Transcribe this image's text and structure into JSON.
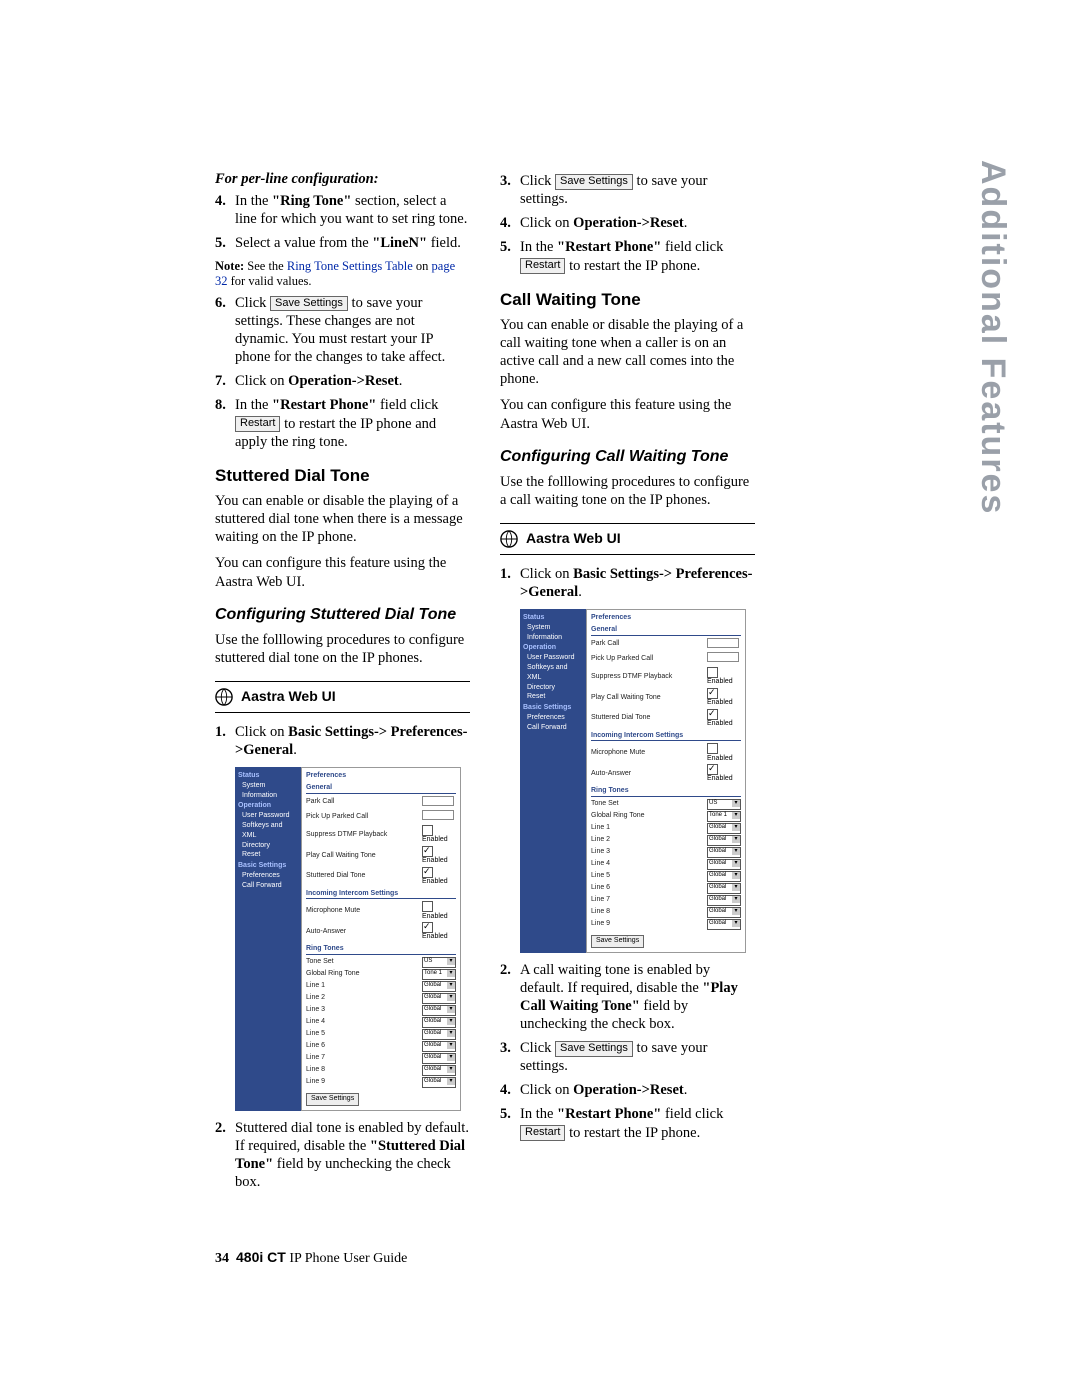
{
  "sideTab": "Additional Features",
  "footer": {
    "page": "34",
    "product": "480i CT",
    "rest": " IP Phone User Guide"
  },
  "leftCol": {
    "perLineHead": "For per-line configuration:",
    "step4": {
      "num": "4.",
      "pre": "In the ",
      "bold1": "\"Ring Tone\"",
      "post": " section, select a line for which you want to set ring tone."
    },
    "step5": {
      "num": "5.",
      "pre": "Select a value from the ",
      "bold1": "\"LineN\"",
      "post": " field."
    },
    "note": {
      "label": "Note:",
      "pre": " See the ",
      "link1": "Ring Tone Settings Table",
      "mid": " on ",
      "link2": "page 32",
      "post": " for valid values."
    },
    "step6": {
      "num": "6.",
      "pre": "Click ",
      "btn": "Save Settings",
      "post": " to save your settings. These changes are not dynamic. You must restart your IP phone for the changes to take affect."
    },
    "step7": {
      "num": "7.",
      "pre": "Click on ",
      "bold1": "Operation->Reset",
      "post": "."
    },
    "step8": {
      "num": "8.",
      "pre": "In the ",
      "bold1": "\"Restart Phone\"",
      "mid": " field click ",
      "btn": "Restart",
      "post": " to restart the IP phone and apply the ring tone."
    },
    "stutteredHead": "Stuttered Dial Tone",
    "stutteredP1": "You can enable or disable the playing of a stuttered dial tone when there is a message waiting on the IP phone.",
    "stutteredP2": "You can configure this feature using the Aastra Web UI.",
    "confStutteredHead": "Configuring Stuttered Dial Tone",
    "confStutteredP": "Use the folllowing procedures to configure stuttered dial tone on the IP phones.",
    "webui": "Aastra Web UI",
    "sStep1": {
      "num": "1.",
      "pre": "Click on ",
      "bold1": "Basic Settings-> Preferences->General",
      "post": "."
    },
    "sStep2": {
      "num": "2.",
      "pre": "Stuttered dial tone is enabled by default. If required, disable the ",
      "bold1": "\"Stuttered Dial Tone\"",
      "post": " field by unchecking the check box."
    }
  },
  "rightCol": {
    "step3": {
      "num": "3.",
      "pre": "Click ",
      "btn": "Save Settings",
      "post": " to save your settings."
    },
    "step4": {
      "num": "4.",
      "pre": "Click on ",
      "bold1": "Operation->Reset",
      "post": "."
    },
    "step5": {
      "num": "5.",
      "pre": "In the ",
      "bold1": "\"Restart Phone\"",
      "mid": " field click ",
      "btn": "Restart",
      "post": " to restart the IP phone."
    },
    "cwHead": "Call Waiting Tone",
    "cwP1": "You can enable or disable the playing of a call waiting tone when a caller is on an active call and a new call comes into the phone.",
    "cwP2": "You can configure this feature using the Aastra Web UI.",
    "confCwHead": "Configuring Call Waiting Tone",
    "confCwP": "Use the folllowing procedures to configure a call waiting tone on the IP phones.",
    "webui": "Aastra Web UI",
    "cStep1": {
      "num": "1.",
      "pre": "Click on ",
      "bold1": "Basic Settings-> Preferences->General",
      "post": "."
    },
    "cStep2": {
      "num": "2.",
      "pre": "A call waiting tone is enabled by default. If required, disable the ",
      "bold1": "\"Play Call Waiting Tone\"",
      "post": " field by unchecking the check box."
    },
    "cStep3": {
      "num": "3.",
      "pre": "Click ",
      "btn": "Save Settings",
      "post": " to save your settings."
    },
    "cStep4": {
      "num": "4.",
      "pre": "Click on ",
      "bold1": "Operation->Reset",
      "post": "."
    },
    "cStep5": {
      "num": "5.",
      "pre": "In the ",
      "bold1": "\"Restart Phone\"",
      "mid": " field click ",
      "btn": "Restart",
      "post": " to restart the IP phone."
    }
  },
  "screenshot": {
    "title": "Preferences",
    "side": {
      "h1": "Status",
      "i1": "System Information",
      "h2": "Operation",
      "i2a": "User Password",
      "i2b": "Softkeys and XML",
      "i2c": "Directory",
      "i2d": "Reset",
      "h3": "Basic Settings",
      "i3a": "Preferences",
      "i3b": "Call Forward"
    },
    "general": {
      "head": "General",
      "r1": "Park Call",
      "r2": "Pick Up Parked Call",
      "r3": "Suppress DTMF Playback",
      "r3v": "Enabled",
      "r4": "Play Call Waiting Tone",
      "r4v": "Enabled",
      "r5": "Stuttered Dial Tone",
      "r5v": "Enabled"
    },
    "intercom": {
      "head": "Incoming Intercom Settings",
      "r1": "Microphone Mute",
      "r1v": "Enabled",
      "r2": "Auto-Answer",
      "r2v": "Enabled"
    },
    "ring": {
      "head": "Ring Tones",
      "r1": "Tone Set",
      "v1": "US",
      "r2": "Global Ring Tone",
      "v2": "Tone 1",
      "lines": [
        "Line 1",
        "Line 2",
        "Line 3",
        "Line 4",
        "Line 5",
        "Line 6",
        "Line 7",
        "Line 8",
        "Line 9"
      ],
      "lval": "Global"
    },
    "save": "Save Settings"
  }
}
